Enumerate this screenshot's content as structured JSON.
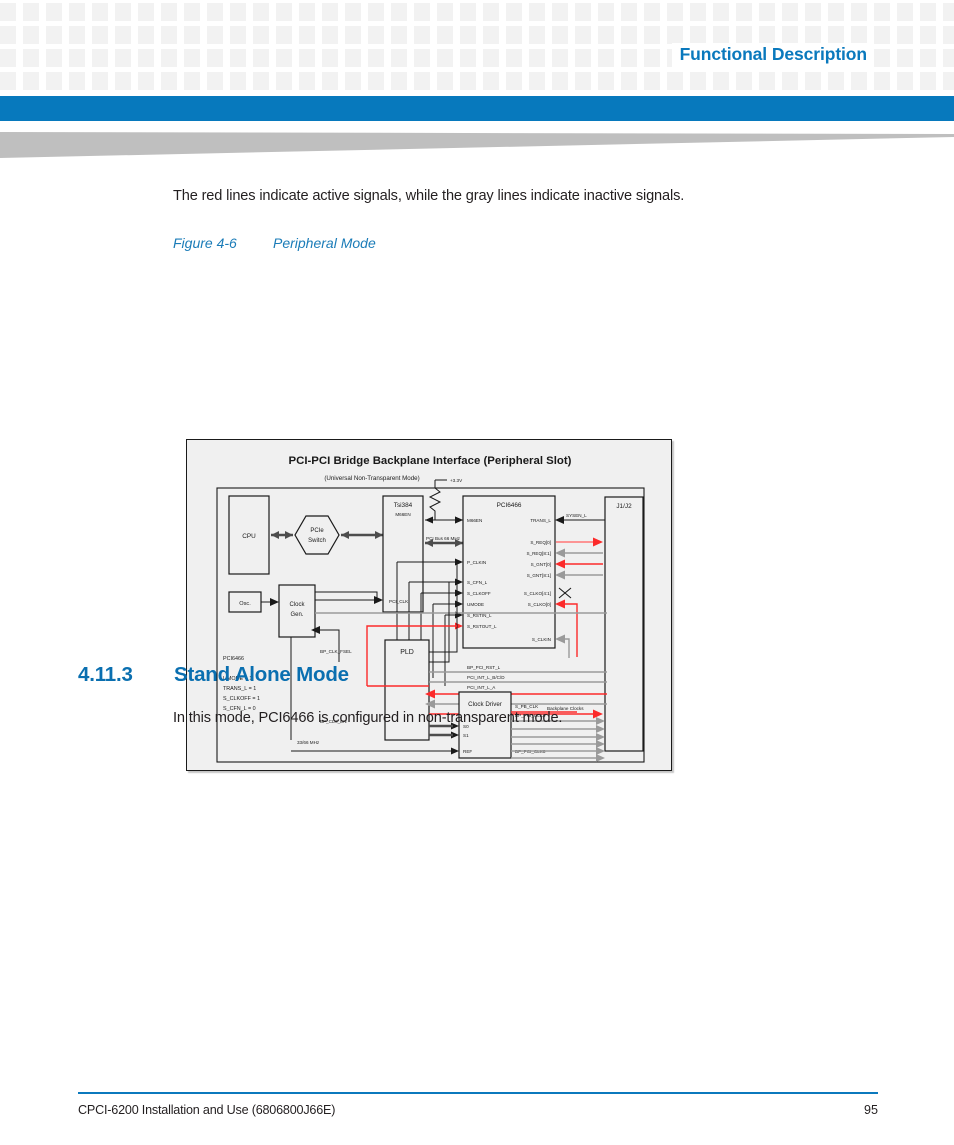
{
  "header": {
    "title": "Functional Description",
    "accent_color": "#0779bd"
  },
  "content": {
    "intro_paragraph": "The red lines indicate active signals, while the gray lines indicate inactive signals.",
    "figure_caption": {
      "number": "Figure 4-6",
      "title": "Peripheral Mode"
    },
    "section": {
      "number": "4.11.3",
      "title": "Stand Alone Mode",
      "paragraph": "In this mode, PCI6466 is configured in non-transparent mode."
    }
  },
  "footer": {
    "document_title": "CPCI-6200 Installation and Use (6806800J66E)",
    "page_number": "95",
    "rule_color": "#0b79bd"
  },
  "figure": {
    "title": "PCI-PCI Bridge Backplane Interface (Peripheral Slot)",
    "subtitle": "(Universal Non-Transparent Mode)",
    "blocks": {
      "cpu": "CPU",
      "pcie_switch_line1": "PCIe",
      "pcie_switch_line2": "Switch",
      "tsi384": "Tsi384",
      "pci6466": "PCI6466",
      "connector": "J1/J2",
      "osc": "Osc.",
      "clock_gen_line1": "Clock",
      "clock_gen_line2": "Gen.",
      "pld": "PLD",
      "clock_driver": "Clock Driver"
    },
    "labels": {
      "voltage": "+3.3V",
      "pci_bus": "PCI Bus 66 MHz",
      "m66en_left": "M66EN",
      "m66en_right": "M66EN",
      "pci_clk": "PCI_CLK",
      "p_clkin": "P_CLKIN",
      "s_cfn_l": "S_CFN_L",
      "s_clkoff": "S_CLKOFF",
      "umode": "UMODE",
      "s_rstin_l": "S_RSTIN_L",
      "s_rstout_l": "S_RSTOUT_L",
      "trans_l": "TRANS_L",
      "sysen_l": "SYSEN_L",
      "s_req0": "S_REQ[0]",
      "s_req81": "S_REQ[8:1]",
      "s_gnt0": "S_GNT[0]",
      "s_gnt81": "S_GNT[8:1]",
      "s_clko41": "S_CLKO[4:1]",
      "s_clko0": "S_CLKO[0]",
      "s_clkin": "S_CLKIN",
      "bp_pci_rst_l": "BP_PCI_RST_L",
      "pci_int_l_bcd": "PCI_INT_L_B/C/D",
      "pci_int_l_a": "PCI_INT_L_A",
      "bp_clk_fsel": "BP_CLK_FSEL",
      "bp_clk_en": "BP_CLK_EN",
      "s_pb_clk": "S_PB_CLK",
      "bp_pci_clk0": "BP_PCI_CLK0",
      "bp_pci_clk8": "BP_PCI_CLK8",
      "backplane_clocks": "Backplane Clocks",
      "freq_note": "33/66 MHz",
      "s0": "S0",
      "s1": "S1",
      "ref": "REF"
    },
    "legend": {
      "device": "PCI6466",
      "line1": "UMODE = 1",
      "line2": "TRANS_L = 1",
      "line3": "S_CLKOFF = 1",
      "line4": "S_CFN_L = 0"
    },
    "colors": {
      "active_signal": "#fc2a2a",
      "inactive_signal": "#9a9a9a",
      "wire": "#1a1a1a"
    }
  }
}
